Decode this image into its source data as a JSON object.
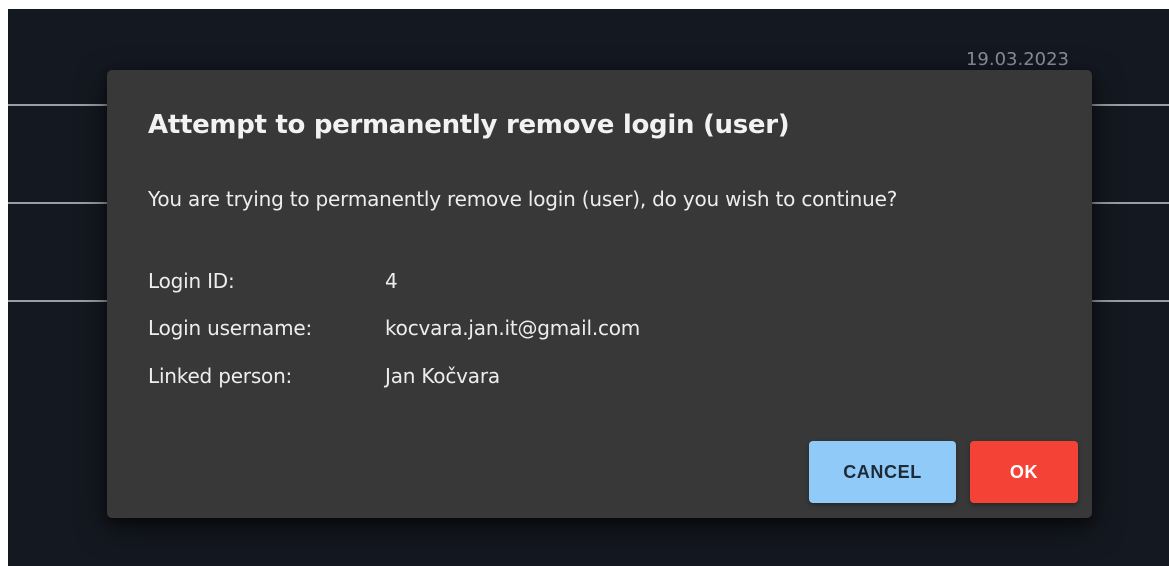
{
  "background": {
    "date": "19.03.2023"
  },
  "dialog": {
    "title": "Attempt to permanently remove login (user)",
    "message": "You are trying to permanently remove login (user), do you wish to continue?",
    "details": [
      {
        "label": "Login ID:",
        "value": "4"
      },
      {
        "label": "Login username:",
        "value": "kocvara.jan.it@gmail.com"
      },
      {
        "label": "Linked person:",
        "value": "Jan Kočvara"
      }
    ],
    "buttons": {
      "cancel_label": "CANCEL",
      "ok_label": "OK"
    }
  },
  "colors": {
    "page_background": "#141820",
    "dialog_background": "#383838",
    "cancel_button": "#90caf9",
    "ok_button": "#f44336"
  }
}
